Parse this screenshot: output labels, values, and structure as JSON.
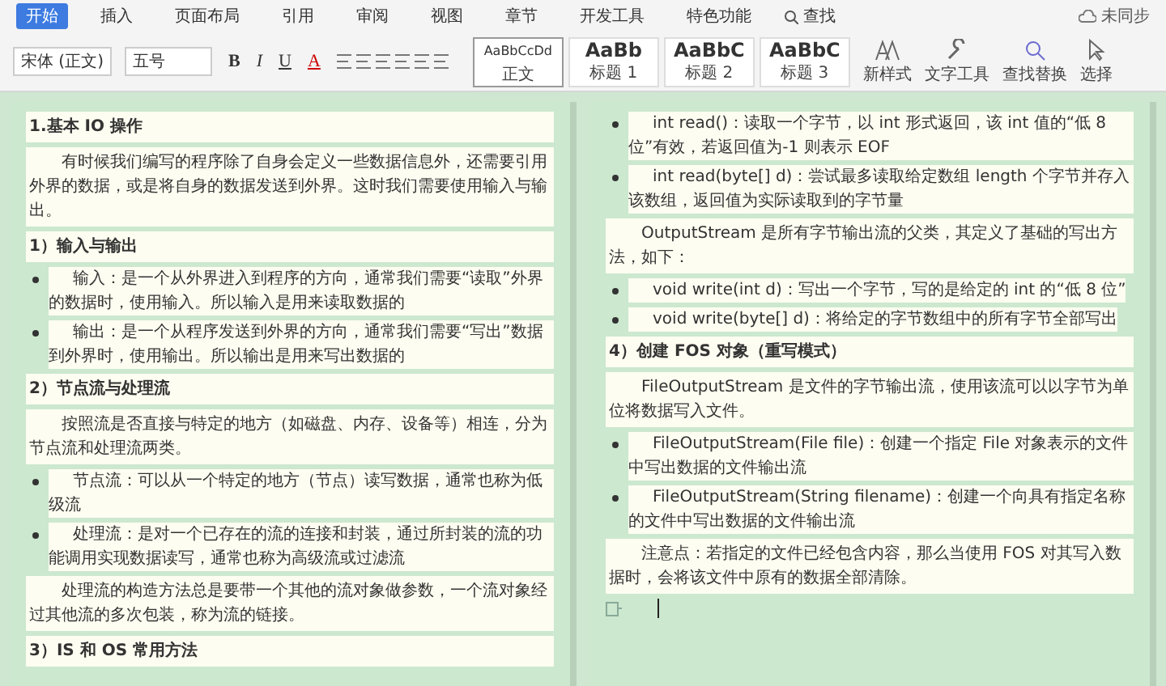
{
  "menu_tabs": [
    {
      "label": "开始",
      "selected": true
    },
    {
      "label": "插入",
      "selected": false
    },
    {
      "label": "页面布局",
      "selected": false
    },
    {
      "label": "引用",
      "selected": false
    },
    {
      "label": "审阅",
      "selected": false
    },
    {
      "label": "视图",
      "selected": false
    },
    {
      "label": "章节",
      "selected": false
    },
    {
      "label": "开发工具",
      "selected": false
    },
    {
      "label": "特色功能",
      "selected": false
    }
  ],
  "search_label": "查找",
  "sync_status": "未同步",
  "font_name": "宋体 (正文)",
  "font_size": "五号",
  "format_buttons": [
    "B",
    "I",
    "U",
    "A"
  ],
  "styles": [
    {
      "preview": "AaBbCcDd",
      "label": "正文",
      "selected": true
    },
    {
      "preview": "AaBb",
      "label": "标题 1",
      "selected": false
    },
    {
      "preview": "AaBbC",
      "label": "标题 2",
      "selected": false
    },
    {
      "preview": "AaBbC",
      "label": "标题 3",
      "selected": false
    }
  ],
  "tools": [
    {
      "kind": "style",
      "label": "新样式"
    },
    {
      "kind": "wrench",
      "label": "文字工具"
    },
    {
      "kind": "find",
      "label": "查找替换"
    },
    {
      "kind": "select",
      "label": "选择"
    }
  ],
  "pages": [
    {
      "blocks": [
        {
          "kind": "heading",
          "text": "1.基本 IO 操作"
        },
        {
          "kind": "para",
          "text": "有时候我们编写的程序除了自身会定义一些数据信息外，还需要引用外界的数据，或是将自身的数据发送到外界。这时我们需要使用输入与输出。"
        },
        {
          "kind": "heading",
          "text": "1）输入与输出"
        },
        {
          "kind": "bullet",
          "text": "输入：是一个从外界进入到程序的方向，通常我们需要“读取”外界的数据时，使用输入。所以输入是用来读取数据的"
        },
        {
          "kind": "bullet",
          "text": "输出：是一个从程序发送到外界的方向，通常我们需要“写出”数据到外界时，使用输出。所以输出是用来写出数据的"
        },
        {
          "kind": "heading",
          "text": "2）节点流与处理流"
        },
        {
          "kind": "para",
          "text": "按照流是否直接与特定的地方（如磁盘、内存、设备等）相连，分为节点流和处理流两类。"
        },
        {
          "kind": "bullet",
          "text": "节点流：可以从一个特定的地方（节点）读写数据，通常也称为低级流"
        },
        {
          "kind": "bullet",
          "text": "处理流：是对一个已存在的流的连接和封装，通过所封装的流的功能调用实现数据读写，通常也称为高级流或过滤流"
        },
        {
          "kind": "para",
          "text": "处理流的构造方法总是要带一个其他的流对象做参数，一个流对象经过其他流的多次包装，称为流的链接。"
        },
        {
          "kind": "heading",
          "text": "3）IS 和 OS 常用方法"
        }
      ]
    },
    {
      "blocks": [
        {
          "kind": "bullet",
          "text": "int read()：读取一个字节，以 int 形式返回，该 int 值的“低 8 位”有效，若返回值为-1 则表示 EOF"
        },
        {
          "kind": "bullet",
          "text": "int read(byte[] d)：尝试最多读取给定数组 length 个字节并存入该数组，返回值为实际读取到的字节量"
        },
        {
          "kind": "para",
          "text": "OutputStream 是所有字节输出流的父类，其定义了基础的写出方法，如下："
        },
        {
          "kind": "bullet",
          "text": "void write(int d)：写出一个字节，写的是给定的 int 的“低 8 位”"
        },
        {
          "kind": "bullet",
          "text": "void write(byte[] d)：将给定的字节数组中的所有字节全部写出"
        },
        {
          "kind": "heading",
          "text": "4）创建 FOS 对象（重写模式）"
        },
        {
          "kind": "para",
          "text": "FileOutputStream 是文件的字节输出流，使用该流可以以字节为单位将数据写入文件。"
        },
        {
          "kind": "bullet",
          "text": "FileOutputStream(File file)：创建一个指定 File 对象表示的文件中写出数据的文件输出流"
        },
        {
          "kind": "bullet",
          "text": "FileOutputStream(String filename)：创建一个向具有指定名称的文件中写出数据的文件输出流"
        },
        {
          "kind": "para",
          "text": "注意点：若指定的文件已经包含内容，那么当使用 FOS 对其写入数据时，会将该文件中原有的数据全部清除。"
        },
        {
          "kind": "cursor"
        }
      ]
    }
  ]
}
